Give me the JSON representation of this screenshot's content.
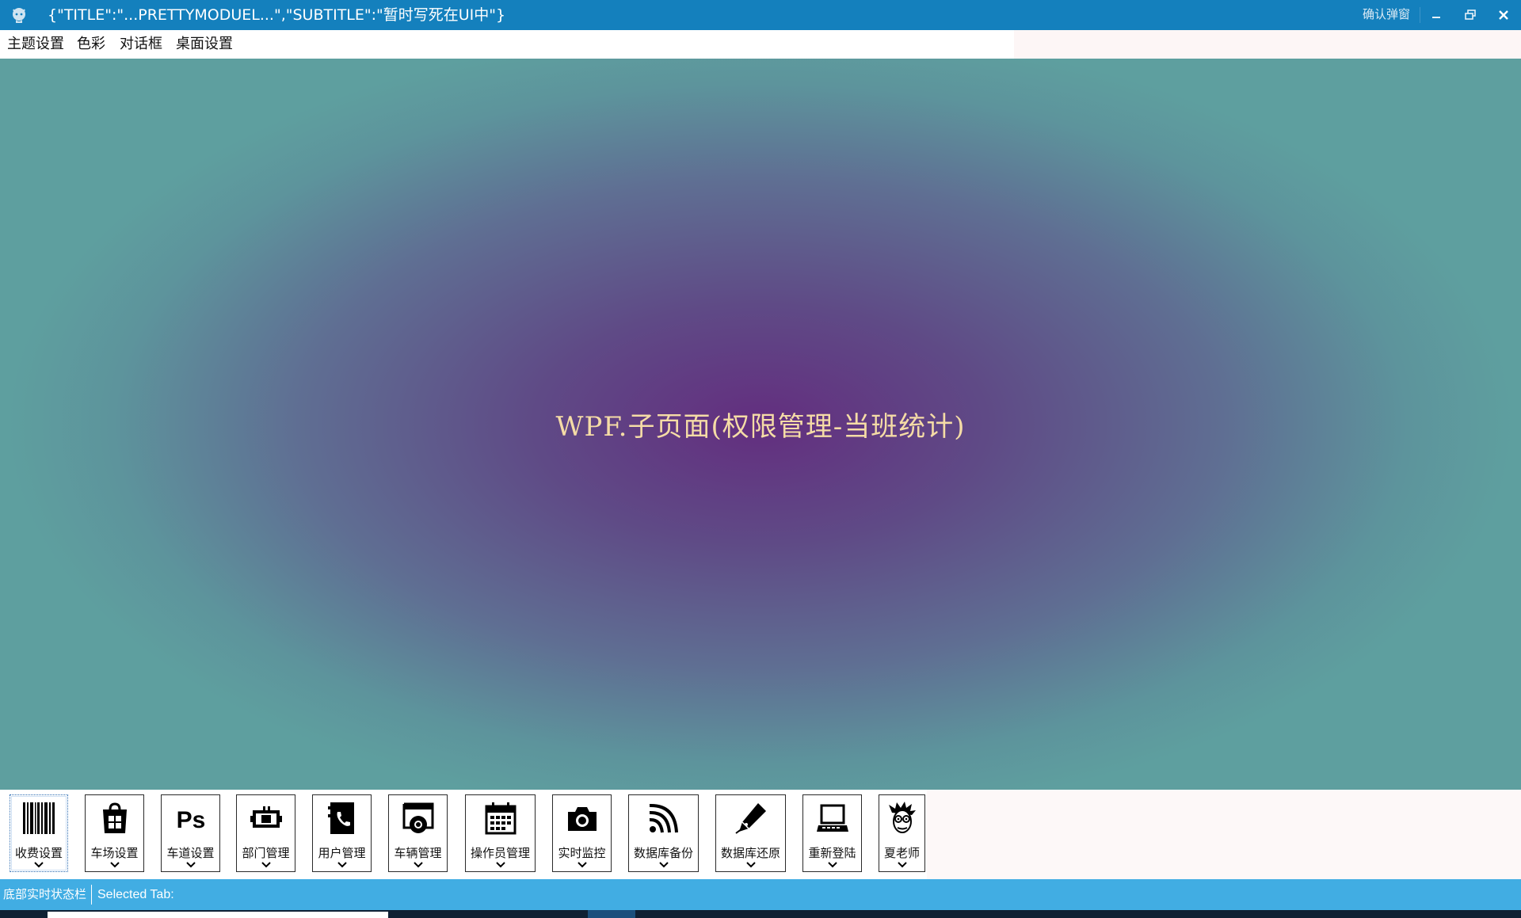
{
  "window": {
    "title": "{\"TITLE\":\"...PRETTYMODUEL...\",\"SUBTITLE\":\"暂时写死在UI中\"}",
    "confirm_popup": "确认弹窗",
    "app_icon": "github-octocat-icon"
  },
  "menu": {
    "items": [
      "主题设置",
      "色彩",
      "对话框",
      "桌面设置"
    ]
  },
  "content": {
    "center_text": "WPF.子页面(权限管理-当班统计)"
  },
  "toolbar": {
    "items": [
      {
        "label": "收费设置",
        "icon": "barcode-icon",
        "selected": true
      },
      {
        "label": "车场设置",
        "icon": "store-icon"
      },
      {
        "label": "车道设置",
        "icon": "photoshop-icon"
      },
      {
        "label": "部门管理",
        "icon": "battery-plug-icon"
      },
      {
        "label": "用户管理",
        "icon": "phone-book-icon"
      },
      {
        "label": "车辆管理",
        "icon": "browser-icon"
      },
      {
        "label": "操作员管理",
        "icon": "calendar-icon"
      },
      {
        "label": "实时监控",
        "icon": "camera-icon"
      },
      {
        "label": "数据库备份",
        "icon": "wifi-icon"
      },
      {
        "label": "数据库还原",
        "icon": "pen-nib-icon"
      },
      {
        "label": "重新登陆",
        "icon": "laptop-icon"
      },
      {
        "label": "夏老师",
        "icon": "cartoon-face-icon"
      }
    ]
  },
  "status": {
    "left": "底部实时状态栏",
    "right": "Selected Tab:"
  },
  "colors": {
    "titlebar": "#1480bd",
    "statusbar": "#41ade3",
    "center_text": "#f5dca6"
  }
}
